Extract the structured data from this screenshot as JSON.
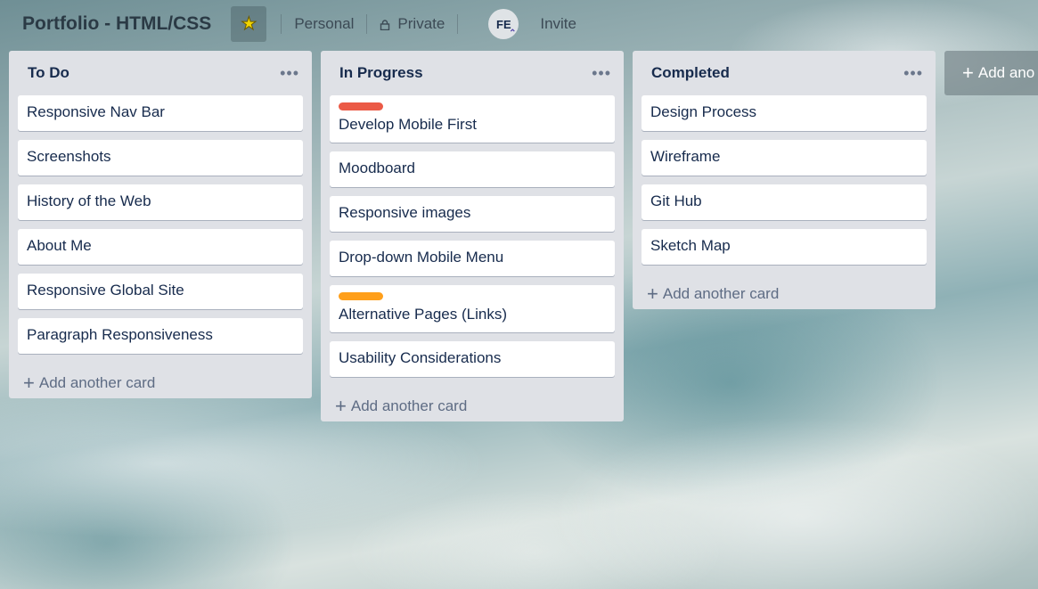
{
  "board": {
    "title": "Portfolio - HTML/CSS",
    "team": "Personal",
    "visibility": "Private",
    "avatar_initials": "FE",
    "invite_label": "Invite"
  },
  "lists": [
    {
      "title": "To Do",
      "cards": [
        {
          "text": "Responsive Nav Bar"
        },
        {
          "text": "Screenshots"
        },
        {
          "text": "History of the Web"
        },
        {
          "text": "About Me"
        },
        {
          "text": "Responsive Global Site"
        },
        {
          "text": "Paragraph Responsiveness"
        }
      ],
      "add_card_label": "Add another card"
    },
    {
      "title": "In Progress",
      "cards": [
        {
          "text": "Develop Mobile First",
          "label_color": "#eb5a46"
        },
        {
          "text": "Moodboard"
        },
        {
          "text": "Responsive images"
        },
        {
          "text": "Drop-down Mobile Menu"
        },
        {
          "text": "Alternative Pages (Links)",
          "label_color": "#ff9f1a"
        },
        {
          "text": "Usability Considerations"
        }
      ],
      "add_card_label": "Add another card"
    },
    {
      "title": "Completed",
      "cards": [
        {
          "text": "Design Process"
        },
        {
          "text": "Wireframe"
        },
        {
          "text": "Git Hub"
        },
        {
          "text": "Sketch Map"
        }
      ],
      "add_card_label": "Add another card"
    }
  ],
  "add_list_label": "Add ano",
  "icons": {
    "star": "star-icon",
    "lock": "lock-icon",
    "more": "more-icon",
    "plus": "plus-icon"
  },
  "colors": {
    "star": "#f2d600",
    "list_bg": "#dfe1e6",
    "card_text": "#172b4d"
  }
}
